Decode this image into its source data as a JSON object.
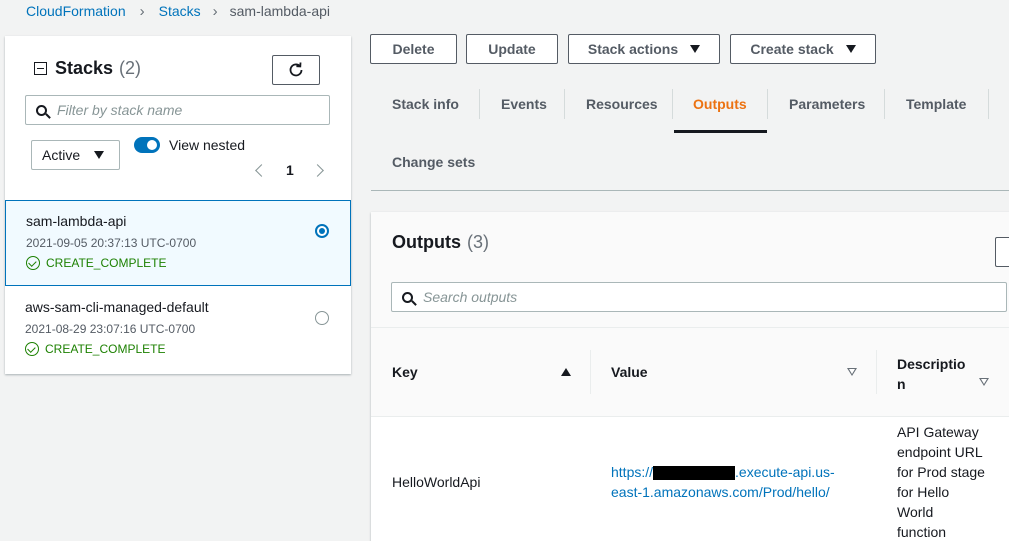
{
  "breadcrumb": {
    "items": [
      "CloudFormation",
      "Stacks"
    ],
    "current": "sam-lambda-api"
  },
  "left_panel": {
    "title": "Stacks",
    "count": "(2)",
    "filter_placeholder": "Filter by stack name",
    "status_filter": "Active",
    "view_nested_label": "View nested",
    "page": "1",
    "stacks": [
      {
        "name": "sam-lambda-api",
        "date": "2021-09-05 20:37:13 UTC-0700",
        "status": "CREATE_COMPLETE",
        "selected": true
      },
      {
        "name": "aws-sam-cli-managed-default",
        "date": "2021-08-29 23:07:16 UTC-0700",
        "status": "CREATE_COMPLETE",
        "selected": false
      }
    ]
  },
  "toolbar": {
    "delete": "Delete",
    "update": "Update",
    "stack_actions": "Stack actions",
    "create_stack": "Create stack"
  },
  "tabs": [
    "Stack info",
    "Events",
    "Resources",
    "Outputs",
    "Parameters",
    "Template",
    "Change sets"
  ],
  "active_tab": "Outputs",
  "outputs": {
    "title": "Outputs",
    "count": "(3)",
    "search_placeholder": "Search outputs",
    "columns": {
      "key": "Key",
      "value": "Value",
      "description_line1": "Descriptio",
      "description_line2": "n"
    },
    "rows": [
      {
        "key": "HelloWorldApi",
        "value_prefix": "https://",
        "value_suffix_line1": ".execute-api.us-",
        "value_line2": "east-1.amazonaws.com/Prod/hello/",
        "description_lines": [
          "API Gateway",
          "endpoint URL",
          "for Prod stage",
          "for Hello",
          "World",
          "function"
        ]
      }
    ]
  },
  "colors": {
    "accent_blue": "#0073bb",
    "active_tab_orange": "#ec7211",
    "success_green": "#1d8102"
  }
}
